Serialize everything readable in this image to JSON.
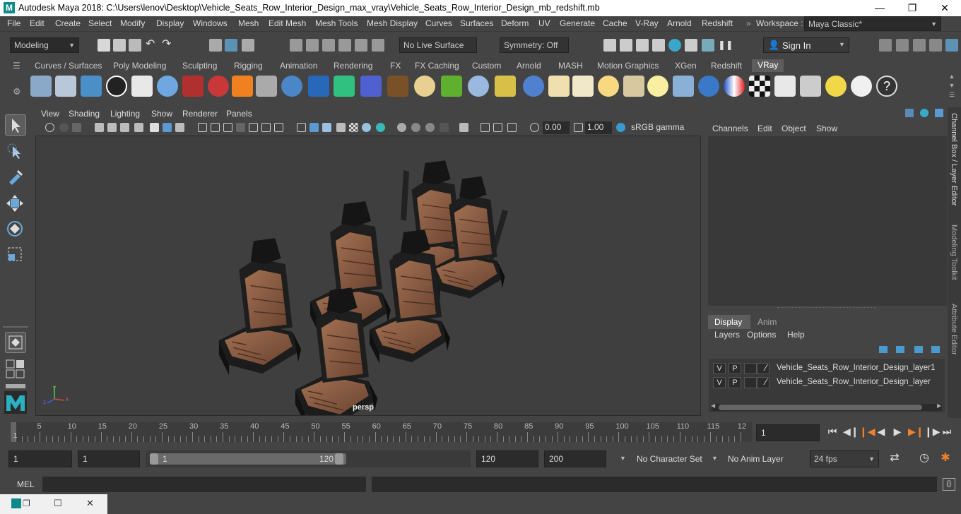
{
  "window": {
    "title": "Autodesk Maya 2018: C:\\Users\\lenov\\Desktop\\Vehicle_Seats_Row_Interior_Design_max_vray\\Vehicle_Seats_Row_Interior_Design_mb_redshift.mb",
    "logo": "M"
  },
  "menu": [
    "File",
    "Edit",
    "Create",
    "Select",
    "Modify",
    "Display",
    "Windows",
    "Mesh",
    "Edit Mesh",
    "Mesh Tools",
    "Mesh Display",
    "Curves",
    "Surfaces",
    "Deform",
    "UV",
    "Generate",
    "Cache",
    "V-Ray",
    "Arnold",
    "Redshift"
  ],
  "workspace": {
    "label": "Workspace :",
    "value": "Maya Classic*"
  },
  "status": {
    "mode": "Modeling",
    "live_surface": "No Live Surface",
    "symmetry": "Symmetry: Off",
    "sign_in": "Sign In"
  },
  "shelf_tabs": [
    "Curves / Surfaces",
    "Poly Modeling",
    "Sculpting",
    "Rigging",
    "Animation",
    "Rendering",
    "FX",
    "FX Caching",
    "Custom",
    "Arnold",
    "MASH",
    "Motion Graphics",
    "XGen",
    "Redshift",
    "VRay"
  ],
  "active_shelf": "VRay",
  "panel_menu": [
    "View",
    "Shading",
    "Lighting",
    "Show",
    "Renderer",
    "Panels"
  ],
  "panel_bar": {
    "exposure": "0.00",
    "gamma": "1.00",
    "colorspace": "sRGB gamma"
  },
  "viewport": {
    "camera": "persp"
  },
  "channel_box": {
    "menu": [
      "Channels",
      "Edit",
      "Object",
      "Show"
    ]
  },
  "layer_editor": {
    "tabs": [
      "Display",
      "Anim"
    ],
    "menu": [
      "Layers",
      "Options",
      "Help"
    ],
    "layers": [
      {
        "v": "V",
        "p": "P",
        "name": "Vehicle_Seats_Row_Interior_Design_layer1"
      },
      {
        "v": "V",
        "p": "P",
        "name": "Vehicle_Seats_Row_Interior_Design_layer"
      }
    ]
  },
  "side_tabs": [
    "Channel Box / Layer Editor",
    "Modeling Toolkit",
    "Attribute Editor"
  ],
  "timeline": {
    "ticks": [
      "5",
      "10",
      "15",
      "20",
      "25",
      "30",
      "35",
      "40",
      "45",
      "50",
      "55",
      "60",
      "65",
      "70",
      "75",
      "80",
      "85",
      "90",
      "95",
      "100",
      "105",
      "110",
      "115",
      "12"
    ],
    "start_marker": "1",
    "current_frame": "1"
  },
  "range": {
    "start": "1",
    "anim_start": "1",
    "slider_start": "1",
    "slider_end": "120",
    "end": "120",
    "anim_end": "200",
    "character_set": "No Character Set",
    "anim_layer": "No Anim Layer",
    "fps": "24 fps"
  },
  "command": {
    "label": "MEL"
  }
}
